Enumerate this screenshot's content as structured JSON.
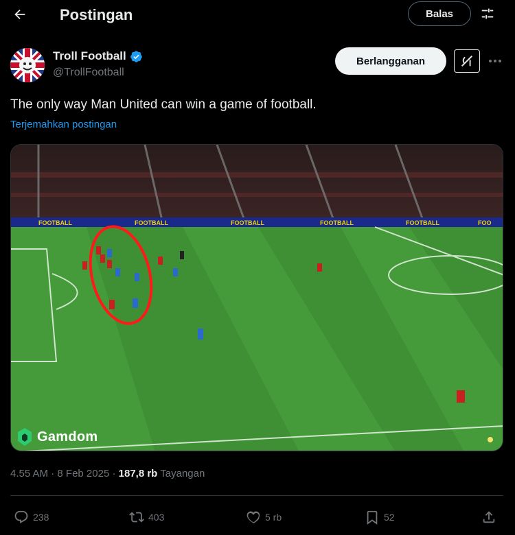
{
  "header": {
    "title": "Postingan",
    "reply_label": "Balas"
  },
  "author": {
    "name": "Troll Football",
    "handle": "@TrollFootball",
    "subscribe_label": "Berlangganan"
  },
  "post": {
    "text": "The only way Man United can win a game of football.",
    "translate_label": "Terjemahkan postingan",
    "media_watermark": "Gamdom"
  },
  "meta": {
    "time": "4.55 AM",
    "date": "8 Feb 2025",
    "separator": "·",
    "views_count": "187,8 rb",
    "views_label": "Tayangan"
  },
  "actions": {
    "replies": "238",
    "reposts": "403",
    "likes": "5 rb",
    "bookmarks": "52"
  },
  "colors": {
    "background": "#000000",
    "text": "#e7e9ea",
    "muted": "#71767b",
    "link": "#1d9bf0",
    "border": "#2f3336",
    "verified": "#1d9bf0"
  },
  "icons": {
    "back": "arrow-left-icon",
    "filter": "sliders-icon",
    "verified": "verified-badge-icon",
    "grok": "grok-icon",
    "more": "more-dots-icon",
    "reply": "speech-bubble-icon",
    "repost": "repost-icon",
    "like": "heart-icon",
    "bookmark": "bookmark-icon",
    "share": "share-icon"
  }
}
